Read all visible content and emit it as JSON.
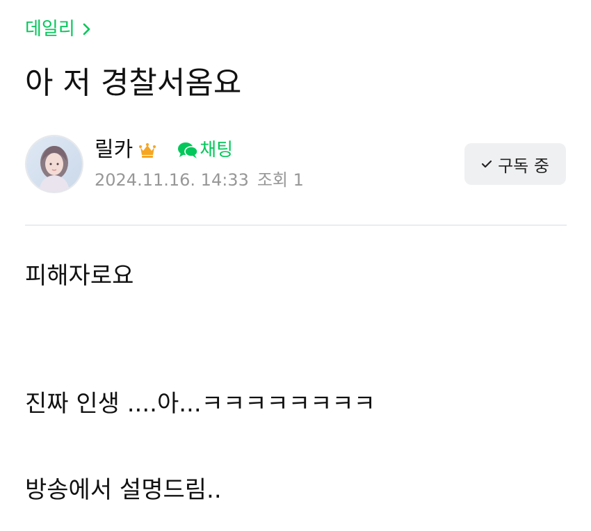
{
  "category": {
    "label": "데일리"
  },
  "post": {
    "title": "아 저 경찰서옴요",
    "body": [
      "피해자로요",
      "진짜 인생 ....아...ㅋㅋㅋㅋㅋㅋㅋㅋ",
      "방송에서 설명드림.."
    ]
  },
  "author": {
    "name": "릴카",
    "badge_icon": "crown-icon",
    "chat_label": "채팅",
    "chat_icon": "chat-bubbles-icon",
    "date": "2024.11.16. 14:33",
    "views_label": "조회 1"
  },
  "subscribe": {
    "label": "구독 중",
    "icon": "check-icon"
  },
  "colors": {
    "accent": "#03c75a",
    "meta": "#979797",
    "button_bg": "#eff0f2",
    "crown": "#f5a623"
  }
}
